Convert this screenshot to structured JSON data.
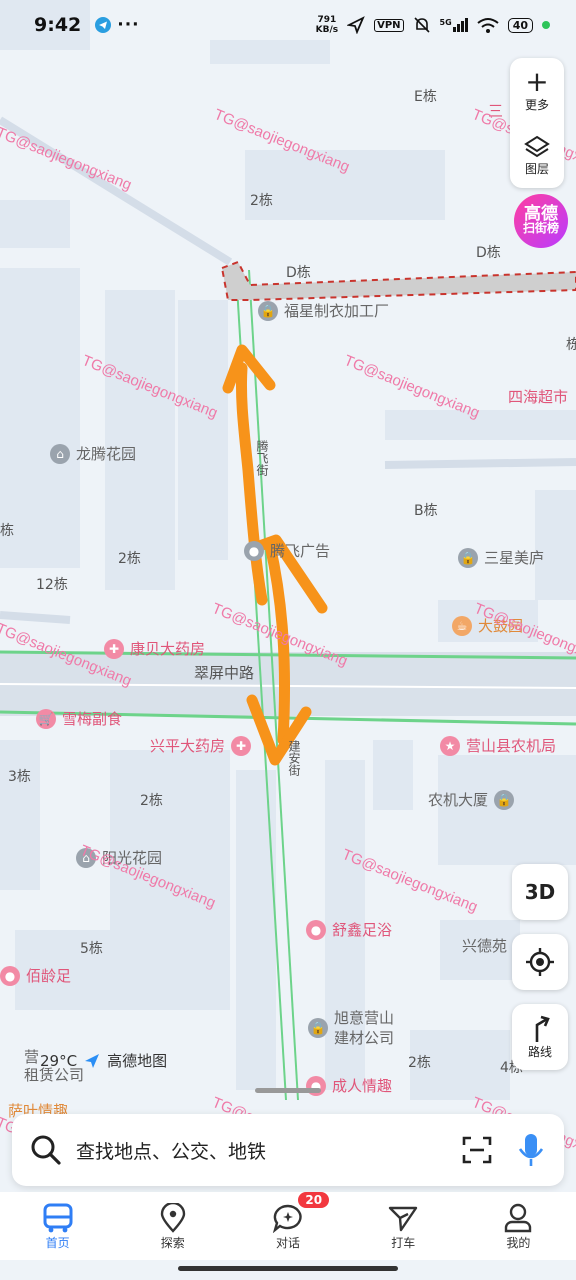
{
  "status_bar": {
    "time": "9:42",
    "speed_value": "791",
    "speed_unit": "KB/s",
    "vpn": "VPN",
    "network": "5G",
    "battery": "40"
  },
  "map": {
    "block_labels": {
      "e_building": "E栋",
      "d_building_top": "D栋",
      "d_building": "D栋",
      "b_building": "B栋",
      "two_a": "2栋",
      "two_b": "2栋",
      "two_c": "2栋",
      "two_d": "2栋",
      "twelve": "12栋",
      "three": "3栋",
      "five": "5栋",
      "four": "4栋",
      "edge_a": "栋",
      "edge_b": "栋"
    },
    "pois": {
      "fuxing": "福星制衣加工厂",
      "longteng": "龙腾花园",
      "tengfei": "腾飞广告",
      "sanxing": "三星美庐",
      "dayuan": "大鼓园",
      "sihai": "四海超市",
      "kangbei": "康贝大药房",
      "xuemei": "雪梅副食",
      "xingping": "兴平大药房",
      "nongji_bureau": "营山县农机局",
      "nongji_building": "农机大厦",
      "yangguang": "阳光花园",
      "shuxin": "舒鑫足浴",
      "xingde": "兴德苑",
      "peiling": "佰龄足",
      "xuyi_1": "旭意营山",
      "xuyi_2": "建材公司",
      "chengren": "成人情趣",
      "rental_1": "营",
      "rental_2": "租赁公司",
      "sanyi": "三",
      "bottom_left": "萨叶情趣"
    },
    "roads": {
      "cuiping": "翠屏中路",
      "jianan": "建安街",
      "tengfei_street": "腾飞街"
    },
    "watermark": "TG@saojiegongxiang"
  },
  "toolbar": {
    "more_label": "更多",
    "layers_label": "图层",
    "scan_title": "高德",
    "scan_sub": "扫街榜",
    "threed_label": "3D",
    "route_label": "路线"
  },
  "weather": {
    "temperature": "29°C",
    "brand": "高德地图"
  },
  "search": {
    "placeholder": "查找地点、公交、地铁"
  },
  "tabs": [
    {
      "label": "首页"
    },
    {
      "label": "探索"
    },
    {
      "label": "对话",
      "badge": "20"
    },
    {
      "label": "打车"
    },
    {
      "label": "我的"
    }
  ],
  "colors": {
    "accent": "#2f7ef5",
    "arrow": "#f7931a",
    "road_green": "#6dd38a",
    "route_dash": "#c9342d"
  }
}
